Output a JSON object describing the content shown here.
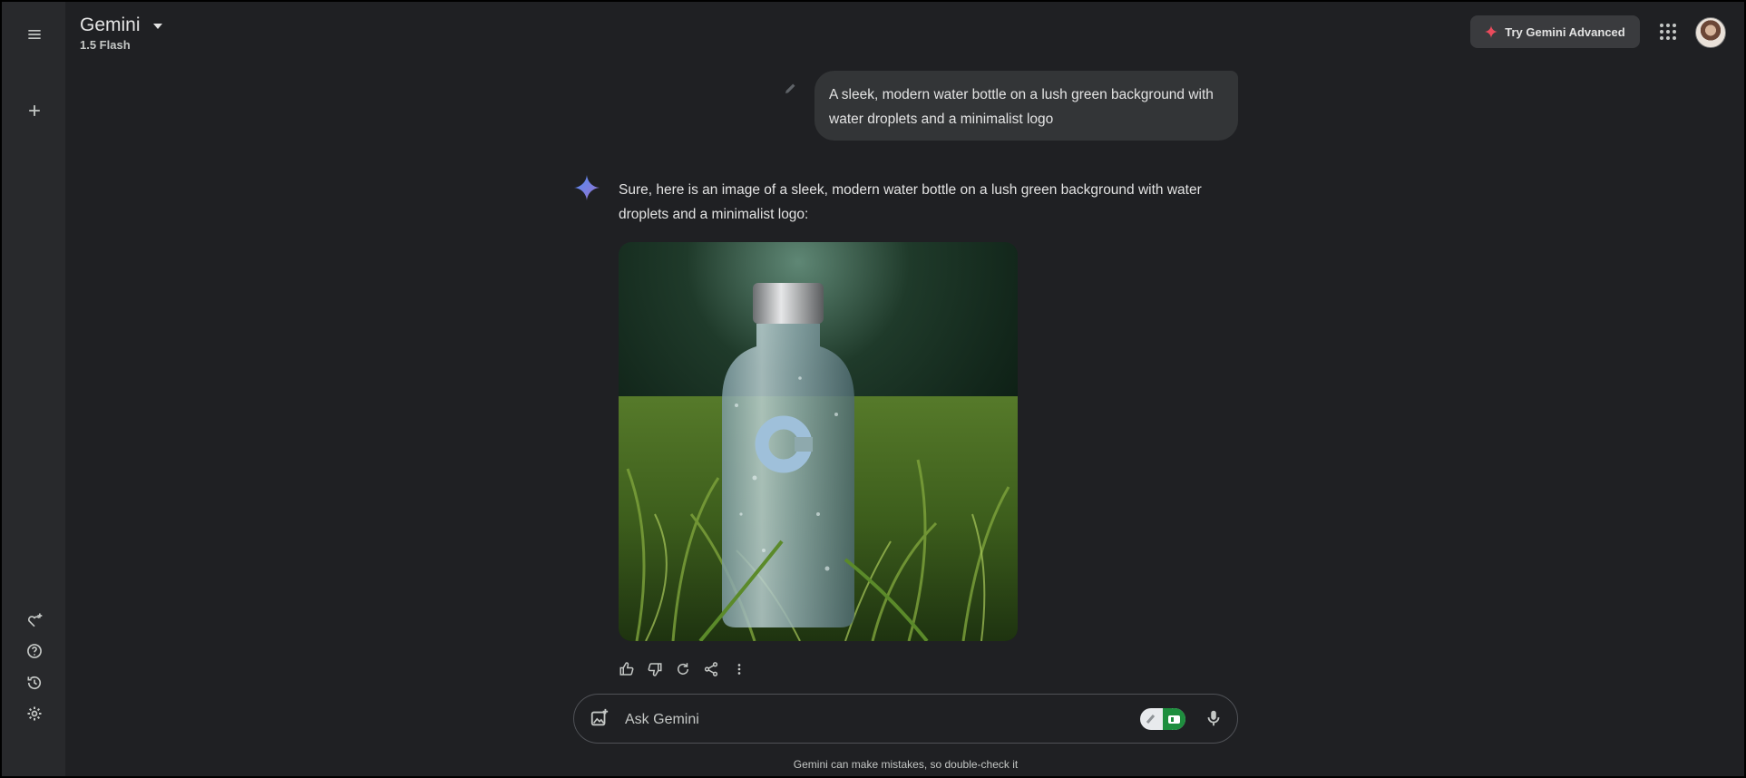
{
  "header": {
    "brand": "Gemini",
    "model": "1.5 Flash",
    "try_button_label": "Try Gemini Advanced"
  },
  "conversation": {
    "user_prompt": "A sleek, modern water bottle on a lush green background with water droplets and a minimalist logo",
    "assistant_text": "Sure, here is an image of a sleek, modern water bottle on a lush green background with water droplets and a minimalist logo:"
  },
  "composer": {
    "placeholder": "Ask Gemini"
  },
  "footer": {
    "disclaimer": "Gemini can make mistakes, so double-check it"
  },
  "icons": {
    "menu": "menu-icon",
    "new_chat": "plus-icon",
    "gem": "gem-icon",
    "help": "help-icon",
    "activity": "history-icon",
    "settings": "gear-icon",
    "spark": "sparkle-icon",
    "apps": "apps-grid-icon",
    "like": "thumbs-up-icon",
    "dislike": "thumbs-down-icon",
    "regenerate": "refresh-icon",
    "share": "share-icon",
    "more": "more-vert-icon",
    "add_image": "add-image-icon",
    "mic": "mic-icon"
  },
  "colors": {
    "background": "#1f2023",
    "sidebar": "#28292c",
    "user_bubble": "#333537",
    "accent_spark": "#ea4b5c",
    "gemini_blue": "#4f8cf7"
  }
}
